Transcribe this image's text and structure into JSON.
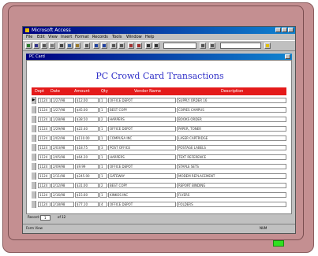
{
  "window": {
    "title": "Microsoft Access"
  },
  "menu": [
    "File",
    "Edit",
    "View",
    "Insert",
    "Format",
    "Records",
    "Tools",
    "Window",
    "Help"
  ],
  "child_window": {
    "title": "PC Card"
  },
  "form": {
    "title": "PC Crowd Card Transactions",
    "columns": [
      "Dept",
      "Date",
      "Amount",
      "Qty",
      "Vendor Name",
      "Description"
    ],
    "rows": [
      {
        "dept": "1124",
        "date": "1/27/98",
        "amount": "$12.00",
        "qty": "1",
        "vendor": "OFFICE DEPOT",
        "desc": "SUPPLY ORDER 16"
      },
      {
        "dept": "1124",
        "date": "1/27/98",
        "amount": "$45.00",
        "qty": "1",
        "vendor": "BEST COPY",
        "desc": "COPIES CAMPUS"
      },
      {
        "dept": "1124",
        "date": "1/28/98",
        "amount": "$38.50",
        "qty": "2",
        "vendor": "HARPERS",
        "desc": "BOOKS ORDER"
      },
      {
        "dept": "1124",
        "date": "1/29/98",
        "amount": "$22.40",
        "qty": "1",
        "vendor": "OFFICE DEPOT",
        "desc": "PAPER, TONER"
      },
      {
        "dept": "1124",
        "date": "2/02/98",
        "amount": "$110.00",
        "qty": "1",
        "vendor": "COMPUSA INC",
        "desc": "LASER CARTRIDGE"
      },
      {
        "dept": "1124",
        "date": "2/03/98",
        "amount": "$18.75",
        "qty": "3",
        "vendor": "POST OFFICE",
        "desc": "POSTAGE LABELS"
      },
      {
        "dept": "1124",
        "date": "2/05/98",
        "amount": "$64.20",
        "qty": "1",
        "vendor": "HARPERS",
        "desc": "TEXT REFERENCE"
      },
      {
        "dept": "1124",
        "date": "2/09/98",
        "amount": "$9.99",
        "qty": "1",
        "vendor": "OFFICE DEPOT",
        "desc": "STAPLE SETS"
      },
      {
        "dept": "1124",
        "date": "2/11/98",
        "amount": "$245.00",
        "qty": "1",
        "vendor": "GATEWAY",
        "desc": "MODEM REPLACEMENT"
      },
      {
        "dept": "1124",
        "date": "2/12/98",
        "amount": "$31.00",
        "qty": "2",
        "vendor": "BEST COPY",
        "desc": "REPORT BINDING"
      },
      {
        "dept": "1124",
        "date": "2/16/98",
        "amount": "$15.60",
        "qty": "1",
        "vendor": "KINKOS INC",
        "desc": "FLYERS"
      },
      {
        "dept": "1124",
        "date": "2/18/98",
        "amount": "$77.10",
        "qty": "4",
        "vendor": "OFFICE DEPOT",
        "desc": "FOLDERS"
      }
    ]
  },
  "nav": {
    "record_label": "Record:",
    "record_value": "1",
    "of_label": "of 12"
  },
  "status": {
    "left": "Form View",
    "right": "NUM"
  }
}
